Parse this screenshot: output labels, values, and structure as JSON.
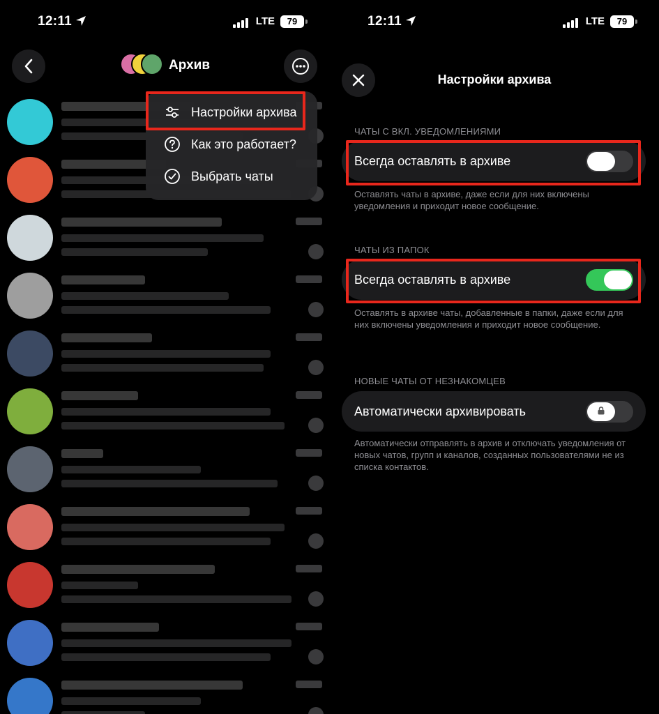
{
  "status_bar": {
    "time": "12:11",
    "network": "LTE",
    "battery": "79"
  },
  "left_screen": {
    "header": {
      "title": "Архив"
    },
    "menu": {
      "items": [
        {
          "label": "Настройки архива",
          "icon": "sliders-icon",
          "highlighted": true
        },
        {
          "label": "Как это работает?",
          "icon": "question-circle-icon"
        },
        {
          "label": "Выбрать чаты",
          "icon": "check-circle-icon"
        }
      ]
    },
    "chat_avatars": [
      "#33c9d6",
      "#e0563a",
      "#cfd8dc",
      "#9e9e9e",
      "#3c4a63",
      "#7fae3d",
      "#5c6470",
      "#d96a60",
      "#c8372f",
      "#3f6fc4",
      "#3577c9"
    ]
  },
  "right_screen": {
    "title": "Настройки архива",
    "sections": [
      {
        "header": "ЧАТЫ С ВКЛ. УВЕДОМЛЕНИЯМИ",
        "label": "Всегда оставлять в архиве",
        "toggle": "off",
        "note": "Оставлять чаты в архиве, даже если для них включены уведомления и приходит новое сообщение."
      },
      {
        "header": "ЧАТЫ ИЗ ПАПОК",
        "label": "Всегда оставлять в архиве",
        "toggle": "on",
        "note": "Оставлять в архиве чаты, добавленные в папки, даже если для них включены уведомления и приходит новое сообщение."
      },
      {
        "header": "НОВЫЕ ЧАТЫ ОТ НЕЗНАКОМЦЕВ",
        "label": "Автоматически архивировать",
        "toggle": "locked",
        "note": "Автоматически отправлять в архив и отключать уведомления от новых чатов, групп и каналов, созданных пользователями не из списка контактов."
      }
    ]
  },
  "colors": {
    "highlight": "#e8271c",
    "toggle_on": "#34c759",
    "secondary_text": "#8e8e93"
  }
}
